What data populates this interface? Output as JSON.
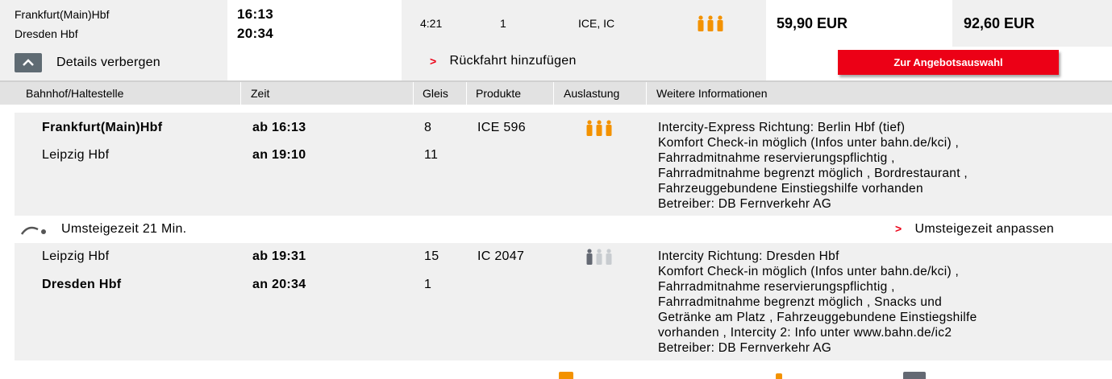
{
  "summary": {
    "from": "Frankfurt(Main)Hbf",
    "to": "Dresden Hbf",
    "dep_time": "16:13",
    "arr_time": "20:34",
    "duration": "4:21",
    "changes": "1",
    "products": "ICE, IC",
    "price_1": "59,90 EUR",
    "price_2": "92,60 EUR",
    "details_toggle": "Details verbergen",
    "return_link": "Rückfahrt hinzufügen",
    "offer_button": "Zur Angebotsauswahl"
  },
  "table_header": {
    "station": "Bahnhof/Haltestelle",
    "time": "Zeit",
    "track": "Gleis",
    "products": "Produkte",
    "occupancy": "Auslastung",
    "info": "Weitere Informationen"
  },
  "legs": [
    {
      "dep_station": "Frankfurt(Main)Hbf",
      "arr_station": "Leipzig Hbf",
      "dep_time": "ab 16:13",
      "arr_time": "an 19:10",
      "dep_track": "8",
      "arr_track": "11",
      "product": "ICE 596",
      "occupancy": "high",
      "info": "Intercity-Express Richtung: Berlin Hbf (tief)\nKomfort Check-in möglich (Infos unter bahn.de/kci) ,\nFahrradmitnahme reservierungspflichtig ,\nFahrradmitnahme begrenzt möglich , Bordrestaurant ,\nFahrzeuggebundene Einstiegshilfe vorhanden\nBetreiber: DB Fernverkehr AG"
    },
    {
      "dep_station": "Leipzig Hbf",
      "arr_station": "Dresden Hbf",
      "dep_time": "ab 19:31",
      "arr_time": "an 20:34",
      "dep_track": "15",
      "arr_track": "1",
      "product": "IC 2047",
      "occupancy": "low",
      "info": "Intercity Richtung: Dresden Hbf\nKomfort Check-in möglich (Infos unter bahn.de/kci) ,\nFahrradmitnahme reservierungspflichtig ,\nFahrradmitnahme begrenzt möglich , Snacks und\nGetränke am Platz , Fahrzeuggebundene Einstiegshilfe\nvorhanden , Intercity 2: Info unter www.bahn.de/ic2\nBetreiber: DB Fernverkehr AG"
    }
  ],
  "transfer": {
    "label": "Umsteigezeit 21 Min.",
    "adjust_link": "Umsteigezeit anpassen"
  },
  "colors": {
    "accent_red": "#ec0016",
    "occupancy_high": "#f39200",
    "occupancy_low_dark": "#646973",
    "occupancy_low_light": "#c8ccd0"
  },
  "icons": {
    "details_toggle": "chevron-up-icon",
    "return_link": "chevron-right-icon",
    "transfer": "walking-transfer-icon",
    "occupancy": "people-occupancy-icon"
  }
}
